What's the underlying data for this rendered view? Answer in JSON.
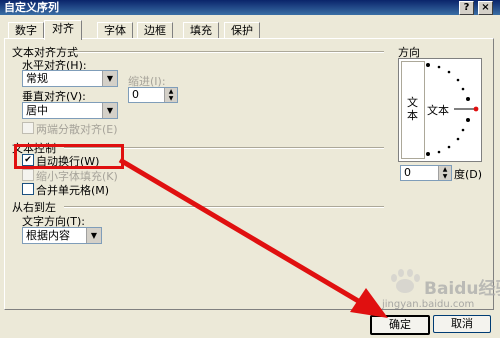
{
  "title": "自定义序列",
  "title_buttons": {
    "help": "?",
    "close": "×"
  },
  "tabs": [
    "数字",
    "对齐",
    "字体",
    "边框",
    "填充",
    "保护"
  ],
  "alignment": {
    "section_title": "文本对齐方式",
    "horizontal_label": "水平对齐(H):",
    "horizontal_value": "常规",
    "indent_label": "缩进(I):",
    "indent_value": "0",
    "vertical_label": "垂直对齐(V):",
    "vertical_value": "居中",
    "justify_distributed": "两端分散对齐(E)"
  },
  "text_control": {
    "section_title": "文本控制",
    "wrap_text": "自动换行(W)",
    "wrap_checked": true,
    "shrink_to_fit": "缩小字体填充(K)",
    "merge_cells": "合并单元格(M)"
  },
  "rtl": {
    "section_title": "从右到左",
    "direction_label": "文字方向(T):",
    "direction_value": "根据内容"
  },
  "orientation": {
    "section_title": "方向",
    "vertical_text": "文本",
    "text": "文本",
    "degrees_value": "0",
    "degrees_label": "度(D)"
  },
  "buttons": {
    "ok": "确定",
    "cancel": "取消"
  },
  "watermark": {
    "brand": "Baidu经验",
    "url": "jingyan.baidu.com"
  },
  "annotation_color": "#e01010"
}
